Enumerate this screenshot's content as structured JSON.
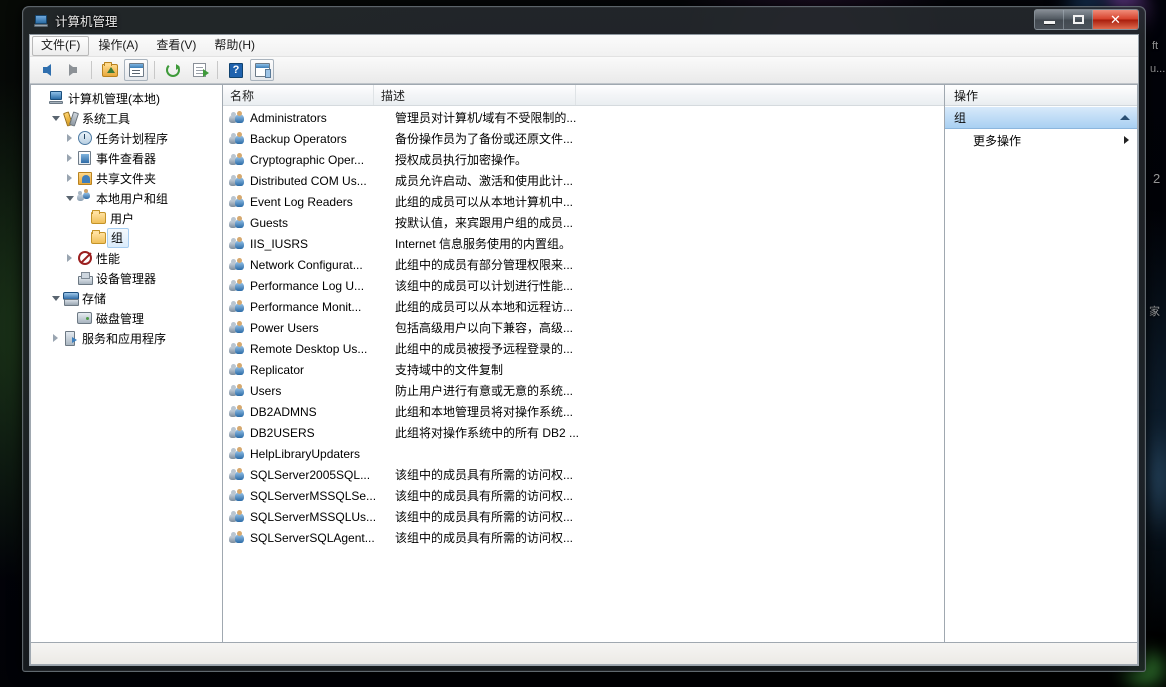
{
  "desktop": {
    "fragments": [
      {
        "name": "desk-text-1",
        "text": "ft"
      },
      {
        "name": "desk-text-2",
        "text": "u..."
      },
      {
        "name": "desk-text-3",
        "text": "2"
      },
      {
        "name": "desk-text-4",
        "text": "家"
      }
    ]
  },
  "window": {
    "title": "计算机管理",
    "icon": "computer-management-icon",
    "buttons": {
      "minimize": "–",
      "maximize": "□",
      "close": "✕"
    }
  },
  "menubar": {
    "items": [
      {
        "label": "文件(F)",
        "focused": true
      },
      {
        "label": "操作(A)",
        "focused": false
      },
      {
        "label": "查看(V)",
        "focused": false
      },
      {
        "label": "帮助(H)",
        "focused": false
      }
    ]
  },
  "toolbar": {
    "buttons": [
      {
        "name": "back-button",
        "icon": "arrow-left-icon",
        "boxed": false
      },
      {
        "name": "forward-button",
        "icon": "arrow-right-icon",
        "boxed": false
      },
      {
        "name": "up-one-level-button",
        "icon": "folder-up-icon",
        "boxed": false
      },
      {
        "name": "show-hide-console-tree-button",
        "icon": "properties-icon",
        "boxed": true
      },
      {
        "name": "refresh-button",
        "icon": "refresh-icon",
        "boxed": false
      },
      {
        "name": "export-list-button",
        "icon": "export-list-icon",
        "boxed": false
      },
      {
        "name": "help-button",
        "icon": "help-icon",
        "boxed": false
      },
      {
        "name": "show-action-pane-button",
        "icon": "show-pane-icon",
        "boxed": true
      }
    ]
  },
  "tree": {
    "nodes": [
      {
        "label": "计算机管理(本地)",
        "indent": 0,
        "twist": "none",
        "icon": "computer-icon",
        "selected": false
      },
      {
        "label": "系统工具",
        "indent": 1,
        "twist": "open",
        "icon": "tools-icon",
        "selected": false
      },
      {
        "label": "任务计划程序",
        "indent": 2,
        "twist": "closed",
        "icon": "clock-icon",
        "selected": false
      },
      {
        "label": "事件查看器",
        "indent": 2,
        "twist": "closed",
        "icon": "event-log-icon",
        "selected": false
      },
      {
        "label": "共享文件夹",
        "indent": 2,
        "twist": "closed",
        "icon": "shared-folder-icon",
        "selected": false
      },
      {
        "label": "本地用户和组",
        "indent": 2,
        "twist": "open",
        "icon": "users-groups-icon",
        "selected": false
      },
      {
        "label": "用户",
        "indent": 3,
        "twist": "none",
        "icon": "folder-icon",
        "selected": false
      },
      {
        "label": "组",
        "indent": 3,
        "twist": "none",
        "icon": "folder-icon",
        "selected": true
      },
      {
        "label": "性能",
        "indent": 2,
        "twist": "closed",
        "icon": "performance-icon",
        "selected": false
      },
      {
        "label": "设备管理器",
        "indent": 2,
        "twist": "none",
        "icon": "device-manager-icon",
        "selected": false
      },
      {
        "label": "存储",
        "indent": 1,
        "twist": "open",
        "icon": "storage-icon",
        "selected": false
      },
      {
        "label": "磁盘管理",
        "indent": 2,
        "twist": "none",
        "icon": "disk-icon",
        "selected": false
      },
      {
        "label": "服务和应用程序",
        "indent": 1,
        "twist": "closed",
        "icon": "services-icon",
        "selected": false
      }
    ]
  },
  "list": {
    "columns": [
      "名称",
      "描述",
      ""
    ],
    "rows": [
      {
        "name": "Administrators",
        "desc": "管理员对计算机/域有不受限制的..."
      },
      {
        "name": "Backup Operators",
        "desc": "备份操作员为了备份或还原文件..."
      },
      {
        "name": "Cryptographic Oper...",
        "desc": "授权成员执行加密操作。"
      },
      {
        "name": "Distributed COM Us...",
        "desc": "成员允许启动、激活和使用此计..."
      },
      {
        "name": "Event Log Readers",
        "desc": "此组的成员可以从本地计算机中..."
      },
      {
        "name": "Guests",
        "desc": "按默认值，来宾跟用户组的成员..."
      },
      {
        "name": "IIS_IUSRS",
        "desc": "Internet 信息服务使用的内置组。"
      },
      {
        "name": "Network Configurat...",
        "desc": "此组中的成员有部分管理权限来..."
      },
      {
        "name": "Performance Log U...",
        "desc": "该组中的成员可以计划进行性能..."
      },
      {
        "name": "Performance Monit...",
        "desc": "此组的成员可以从本地和远程访..."
      },
      {
        "name": "Power Users",
        "desc": "包括高级用户以向下兼容，高级..."
      },
      {
        "name": "Remote Desktop Us...",
        "desc": "此组中的成员被授予远程登录的..."
      },
      {
        "name": "Replicator",
        "desc": "支持域中的文件复制"
      },
      {
        "name": "Users",
        "desc": "防止用户进行有意或无意的系统..."
      },
      {
        "name": "DB2ADMNS",
        "desc": "此组和本地管理员将对操作系统..."
      },
      {
        "name": "DB2USERS",
        "desc": "此组将对操作系统中的所有 DB2 ..."
      },
      {
        "name": "HelpLibraryUpdaters",
        "desc": ""
      },
      {
        "name": "SQLServer2005SQL...",
        "desc": "该组中的成员具有所需的访问权..."
      },
      {
        "name": "SQLServerMSSQLSe...",
        "desc": "该组中的成员具有所需的访问权..."
      },
      {
        "name": "SQLServerMSSQLUs...",
        "desc": "该组中的成员具有所需的访问权..."
      },
      {
        "name": "SQLServerSQLAgent...",
        "desc": "该组中的成员具有所需的访问权..."
      }
    ]
  },
  "actions": {
    "title": "操作",
    "group_header": "组",
    "items": [
      {
        "label": "更多操作",
        "submenu": true
      }
    ]
  },
  "statusbar": {
    "text": ""
  },
  "colors": {
    "selection_blue": "#a9d0f2",
    "close_red": "#d6422c",
    "window_bg": "#f0f0f0",
    "pane_bg": "#ffffff"
  }
}
